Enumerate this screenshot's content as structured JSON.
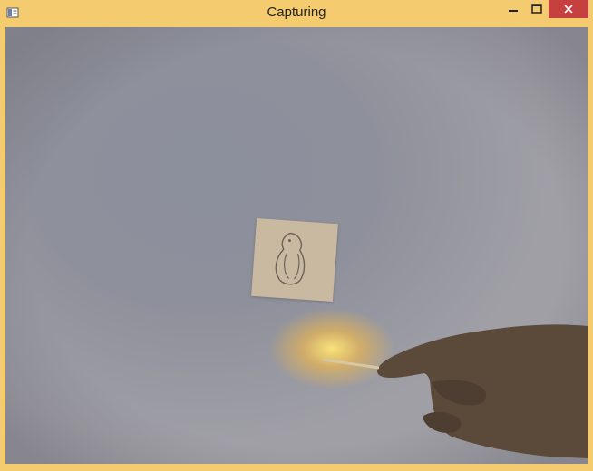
{
  "window": {
    "title": "Capturing",
    "accent_color": "#f4cb6e",
    "close_color": "#c74040"
  },
  "icons": {
    "app": "app-window-icon",
    "minimize": "minimize-icon",
    "maximize": "maximize-icon",
    "close": "close-icon"
  }
}
